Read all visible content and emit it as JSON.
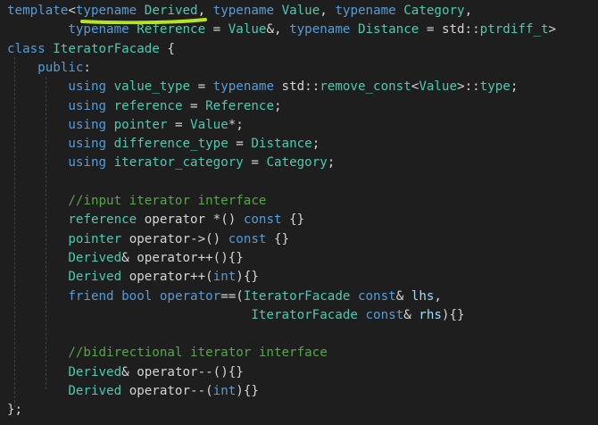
{
  "colors": {
    "background": "#1e1e1e",
    "keyword": "#569cd6",
    "type": "#4ec9b0",
    "identifier": "#9cdcfe",
    "function": "#dcdcaa",
    "comment": "#57a64a",
    "punctuation": "#d4d4d4",
    "highlight_marker": "#b4e61e"
  },
  "lines": [
    [
      [
        "kw",
        "template"
      ],
      [
        "punc",
        "<"
      ],
      [
        "kw",
        "typename"
      ],
      [
        "punc",
        " "
      ],
      [
        "type",
        "Derived"
      ],
      [
        "punc",
        ", "
      ],
      [
        "kw",
        "typename"
      ],
      [
        "punc",
        " "
      ],
      [
        "type",
        "Value"
      ],
      [
        "punc",
        ", "
      ],
      [
        "kw",
        "typename"
      ],
      [
        "punc",
        " "
      ],
      [
        "type",
        "Category"
      ],
      [
        "punc",
        ","
      ]
    ],
    [
      [
        "punc",
        "        "
      ],
      [
        "kw",
        "typename"
      ],
      [
        "punc",
        " "
      ],
      [
        "type",
        "Reference"
      ],
      [
        "punc",
        " = "
      ],
      [
        "type",
        "Value"
      ],
      [
        "punc",
        "&, "
      ],
      [
        "kw",
        "typename"
      ],
      [
        "punc",
        " "
      ],
      [
        "type",
        "Distance"
      ],
      [
        "punc",
        " = "
      ],
      [
        "plain",
        "std::"
      ],
      [
        "type",
        "ptrdiff_t"
      ],
      [
        "punc",
        ">"
      ]
    ],
    [
      [
        "kw",
        "class"
      ],
      [
        "punc",
        " "
      ],
      [
        "type",
        "IteratorFacade"
      ],
      [
        "punc",
        " {"
      ]
    ],
    [
      [
        "punc",
        "    "
      ],
      [
        "kw",
        "public"
      ],
      [
        "punc",
        ":"
      ]
    ],
    [
      [
        "punc",
        "        "
      ],
      [
        "kw",
        "using"
      ],
      [
        "punc",
        " "
      ],
      [
        "type",
        "value_type"
      ],
      [
        "punc",
        " = "
      ],
      [
        "kw",
        "typename"
      ],
      [
        "punc",
        " "
      ],
      [
        "plain",
        "std::"
      ],
      [
        "type",
        "remove_const"
      ],
      [
        "punc",
        "<"
      ],
      [
        "type",
        "Value"
      ],
      [
        "punc",
        ">::"
      ],
      [
        "type",
        "type"
      ],
      [
        "punc",
        ";"
      ]
    ],
    [
      [
        "punc",
        "        "
      ],
      [
        "kw",
        "using"
      ],
      [
        "punc",
        " "
      ],
      [
        "type",
        "reference"
      ],
      [
        "punc",
        " = "
      ],
      [
        "type",
        "Reference"
      ],
      [
        "punc",
        ";"
      ]
    ],
    [
      [
        "punc",
        "        "
      ],
      [
        "kw",
        "using"
      ],
      [
        "punc",
        " "
      ],
      [
        "type",
        "pointer"
      ],
      [
        "punc",
        " = "
      ],
      [
        "type",
        "Value"
      ],
      [
        "punc",
        "*;"
      ]
    ],
    [
      [
        "punc",
        "        "
      ],
      [
        "kw",
        "using"
      ],
      [
        "punc",
        " "
      ],
      [
        "type",
        "difference_type"
      ],
      [
        "punc",
        " = "
      ],
      [
        "type",
        "Distance"
      ],
      [
        "punc",
        ";"
      ]
    ],
    [
      [
        "punc",
        "        "
      ],
      [
        "kw",
        "using"
      ],
      [
        "punc",
        " "
      ],
      [
        "type",
        "iterator_category"
      ],
      [
        "punc",
        " = "
      ],
      [
        "type",
        "Category"
      ],
      [
        "punc",
        ";"
      ]
    ],
    [],
    [
      [
        "punc",
        "        "
      ],
      [
        "com",
        "//input iterator interface"
      ]
    ],
    [
      [
        "punc",
        "        "
      ],
      [
        "type",
        "reference"
      ],
      [
        "punc",
        " "
      ],
      [
        "plain",
        "operator"
      ],
      [
        "punc",
        " *() "
      ],
      [
        "kw",
        "const"
      ],
      [
        "punc",
        " {}"
      ]
    ],
    [
      [
        "punc",
        "        "
      ],
      [
        "type",
        "pointer"
      ],
      [
        "punc",
        " "
      ],
      [
        "plain",
        "operator"
      ],
      [
        "punc",
        "->() "
      ],
      [
        "kw",
        "const"
      ],
      [
        "punc",
        " {}"
      ]
    ],
    [
      [
        "punc",
        "        "
      ],
      [
        "type",
        "Derived"
      ],
      [
        "punc",
        "& "
      ],
      [
        "plain",
        "operator"
      ],
      [
        "punc",
        "++(){}"
      ]
    ],
    [
      [
        "punc",
        "        "
      ],
      [
        "type",
        "Derived"
      ],
      [
        "punc",
        " "
      ],
      [
        "plain",
        "operator"
      ],
      [
        "punc",
        "++("
      ],
      [
        "kw",
        "int"
      ],
      [
        "punc",
        "){}"
      ]
    ],
    [
      [
        "punc",
        "        "
      ],
      [
        "kw",
        "friend"
      ],
      [
        "punc",
        " "
      ],
      [
        "kw",
        "bool"
      ],
      [
        "punc",
        " "
      ],
      [
        "kw",
        "operator"
      ],
      [
        "punc",
        "==("
      ],
      [
        "type",
        "IteratorFacade"
      ],
      [
        "punc",
        " "
      ],
      [
        "kw",
        "const"
      ],
      [
        "punc",
        "& "
      ],
      [
        "var",
        "lhs"
      ],
      [
        "punc",
        ","
      ]
    ],
    [
      [
        "punc",
        "                                "
      ],
      [
        "type",
        "IteratorFacade"
      ],
      [
        "punc",
        " "
      ],
      [
        "kw",
        "const"
      ],
      [
        "punc",
        "& "
      ],
      [
        "var",
        "rhs"
      ],
      [
        "punc",
        "){}"
      ]
    ],
    [],
    [
      [
        "punc",
        "        "
      ],
      [
        "com",
        "//bidirectional iterator interface"
      ]
    ],
    [
      [
        "punc",
        "        "
      ],
      [
        "type",
        "Derived"
      ],
      [
        "punc",
        "& "
      ],
      [
        "plain",
        "operator"
      ],
      [
        "punc",
        "--(){}"
      ]
    ],
    [
      [
        "punc",
        "        "
      ],
      [
        "type",
        "Derived"
      ],
      [
        "punc",
        " "
      ],
      [
        "plain",
        "operator"
      ],
      [
        "punc",
        "--("
      ],
      [
        "kw",
        "int"
      ],
      [
        "punc",
        "){}"
      ]
    ],
    [
      [
        "punc",
        "};"
      ]
    ]
  ]
}
